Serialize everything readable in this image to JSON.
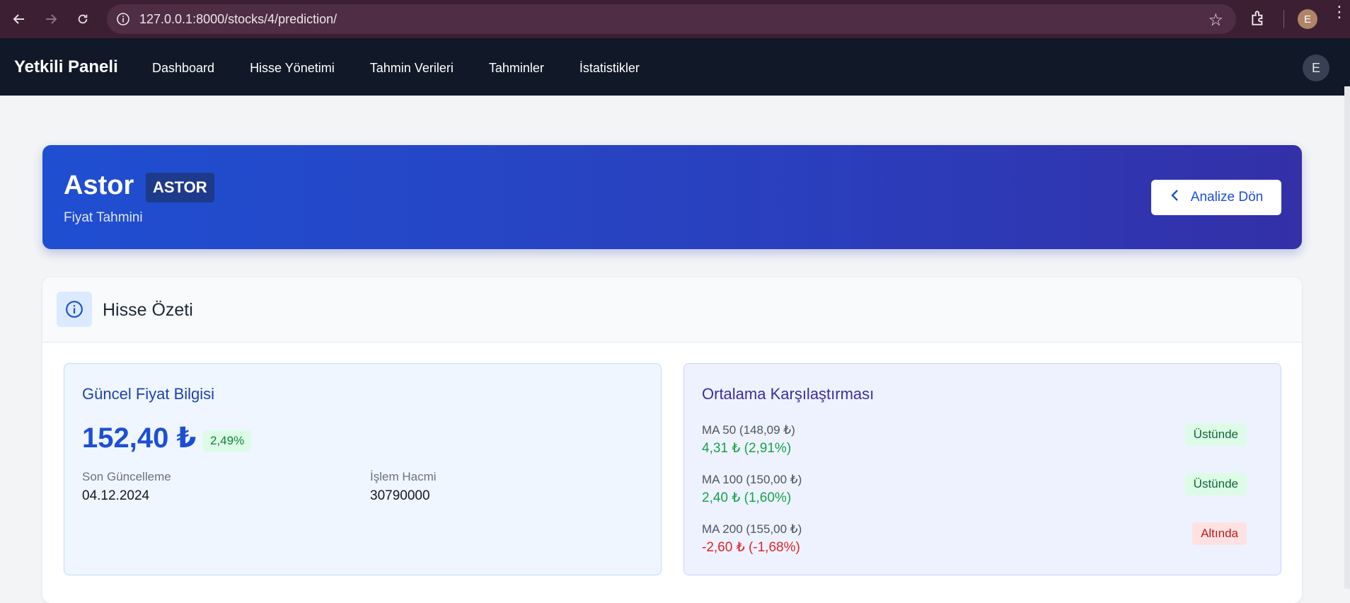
{
  "browser": {
    "url": "127.0.0.1:8000/stocks/4/prediction/",
    "profile_initial": "E"
  },
  "navbar": {
    "brand": "Yetkili Paneli",
    "links": [
      "Dashboard",
      "Hisse Yönetimi",
      "Tahmin Verileri",
      "Tahminler",
      "İstatistikler"
    ],
    "user_initial": "E"
  },
  "hero": {
    "name": "Astor",
    "ticker": "ASTOR",
    "subtitle": "Fiyat Tahmini",
    "back_label": "Analize Dön"
  },
  "summary": {
    "title": "Hisse Özeti",
    "current": {
      "title": "Güncel Fiyat Bilgisi",
      "price": "152,40 ₺",
      "change": "2,49%",
      "last_update_label": "Son Güncelleme",
      "last_update_value": "04.12.2024",
      "volume_label": "İşlem Hacmi",
      "volume_value": "30790000"
    },
    "ma_compare": {
      "title": "Ortalama Karşılaştırması",
      "rows": [
        {
          "label": "MA 50 (148,09 ₺)",
          "diff": "4,31 ₺ (2,91%)",
          "status": "Üstünde"
        },
        {
          "label": "MA 100 (150,00 ₺)",
          "diff": "2,40 ₺ (1,60%)",
          "status": "Üstünde"
        },
        {
          "label": "MA 200 (155,00 ₺)",
          "diff": "-2,60 ₺ (-1,68%)",
          "status": "Altında"
        }
      ]
    }
  },
  "colors": {
    "accent": "#1d4ed8",
    "positive": "#16a34a",
    "negative": "#dc2626"
  }
}
